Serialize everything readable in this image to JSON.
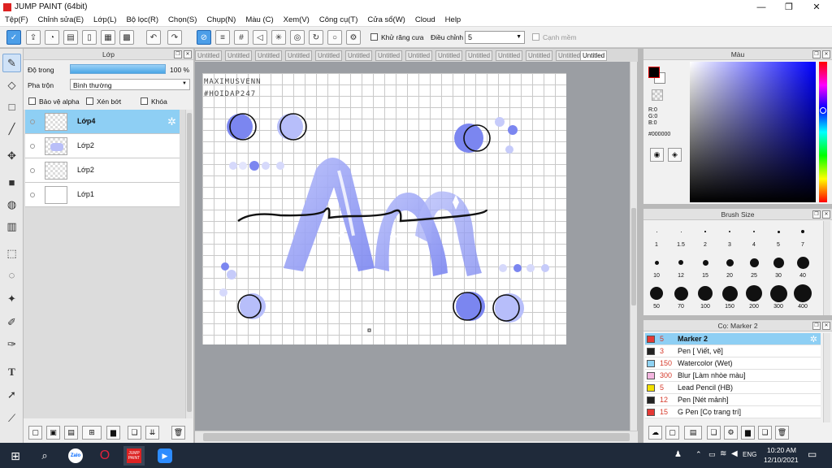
{
  "window": {
    "title": "JUMP PAINT (64bit)",
    "controls": [
      "—",
      "❐",
      "✕"
    ]
  },
  "menu": [
    "Tệp(F)",
    "Chỉnh sửa(E)",
    "Lớp(L)",
    "Bộ lọc(R)",
    "Chọn(S)",
    "Chụp(N)",
    "Màu (C)",
    "Xem(V)",
    "Công cụ(T)",
    "Cửa sổ(W)",
    "Cloud",
    "Help"
  ],
  "toolbar": {
    "antialias_label": "Khử răng cưa",
    "adjust_label": "Điều chỉnh",
    "adjust_value": "5",
    "smooth_label": "Cạnh mềm"
  },
  "layers": {
    "panel_title": "Lớp",
    "opacity_label": "Độ trong",
    "opacity_value": "100 %",
    "opacity_fraction": 1.0,
    "blend_label": "Pha trộn",
    "blend_value": "Bình thường",
    "protect_alpha": "Bảo vệ alpha",
    "clipping": "Xén bớt",
    "lock": "Khóa",
    "items": [
      {
        "name": "Lớp4",
        "selected": true
      },
      {
        "name": "Lớp2",
        "selected": false
      },
      {
        "name": "Lớp2",
        "selected": false
      },
      {
        "name": "Lớp1",
        "selected": false
      }
    ]
  },
  "tabs": [
    "Untitled",
    "Untitled",
    "Untitled",
    "Untitled",
    "Untitled",
    "Untitled",
    "Untitled",
    "Untitled",
    "Untitled",
    "Untitled",
    "Untitled",
    "Untitled",
    "Untitled",
    "Untitled"
  ],
  "canvas": {
    "watermark_line1": "MAXIMUSVENN",
    "watermark_line2": "#HOIDAP247",
    "art_colors": {
      "primary": "#7b86f0",
      "light": "#b7befa",
      "stroke": "#111111"
    }
  },
  "color_panel": {
    "title": "Màu",
    "r": "R:0",
    "g": "G:0",
    "b": "B:0",
    "hex": "#000000"
  },
  "brush_size": {
    "title": "Brush Size",
    "sizes": [
      "1",
      "1.5",
      "2",
      "3",
      "4",
      "5",
      "7",
      "10",
      "12",
      "15",
      "20",
      "25",
      "30",
      "40",
      "50",
      "70",
      "100",
      "150",
      "200",
      "300",
      "400"
    ]
  },
  "brush_list": {
    "title": "Cọ: Marker 2",
    "items": [
      {
        "size": "5",
        "name": "Marker 2",
        "color": "#e53935",
        "selected": true
      },
      {
        "size": "3",
        "name": "Pen [ Viết, vẽ]",
        "color": "#222222",
        "selected": false
      },
      {
        "size": "150",
        "name": "Watercolor (Wet)",
        "color": "#8fd3f4",
        "selected": false
      },
      {
        "size": "300",
        "name": "Blur [Làm nhòe màu]",
        "color": "#f4b6e0",
        "selected": false
      },
      {
        "size": "5",
        "name": "Lead Pencil (HB)",
        "color": "#f2e000",
        "selected": false
      },
      {
        "size": "12",
        "name": "Pen [Nét mảnh]",
        "color": "#222222",
        "selected": false
      },
      {
        "size": "15",
        "name": "G Pen [Cọ trang trí]",
        "color": "#e53935",
        "selected": false
      }
    ]
  },
  "taskbar": {
    "lang": "ENG",
    "time": "10:20 AM",
    "date": "12/10/2021",
    "apps": [
      "Zalo",
      "Opera",
      "JUMP PAINT",
      "Zoom"
    ]
  }
}
